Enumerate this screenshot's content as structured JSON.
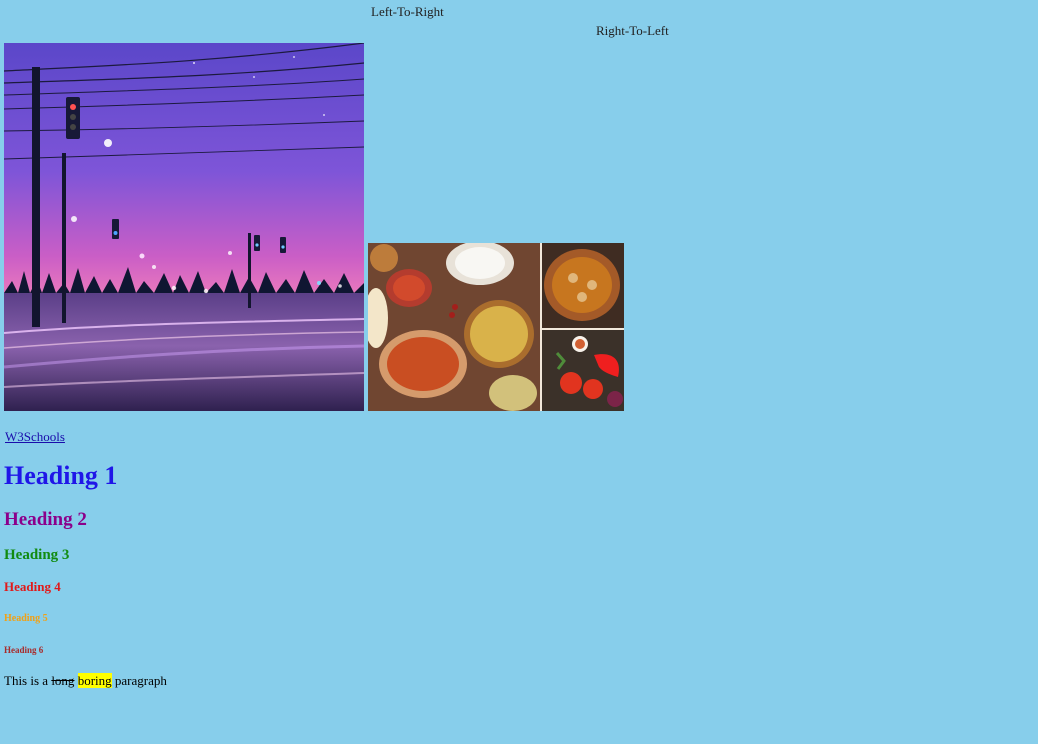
{
  "page": {
    "ltr_label": "Left-To-Right",
    "rtl_label": "Right-To-Left"
  },
  "images": {
    "left": {
      "name": "sunset-street-image"
    },
    "right": {
      "name": "food-collage-image"
    }
  },
  "link": {
    "text": "W3Schools"
  },
  "headings": {
    "h1": "Heading 1",
    "h2": "Heading 2",
    "h3": "Heading 3",
    "h4": "Heading 4",
    "h5": "Heading 5",
    "h6": "Heading 6"
  },
  "paragraph": {
    "prefix": "This is a ",
    "struck": "long",
    "space1": " ",
    "marked": "boring",
    "suffix": " paragraph"
  },
  "colors": {
    "background": "#87ceeb",
    "h1": "#1f16e8",
    "h2": "#8b008b",
    "h3": "#118b11",
    "h4": "#e11a1a",
    "h5": "#f0a116",
    "h6": "#a82b2b",
    "highlight": "#ffff00"
  }
}
